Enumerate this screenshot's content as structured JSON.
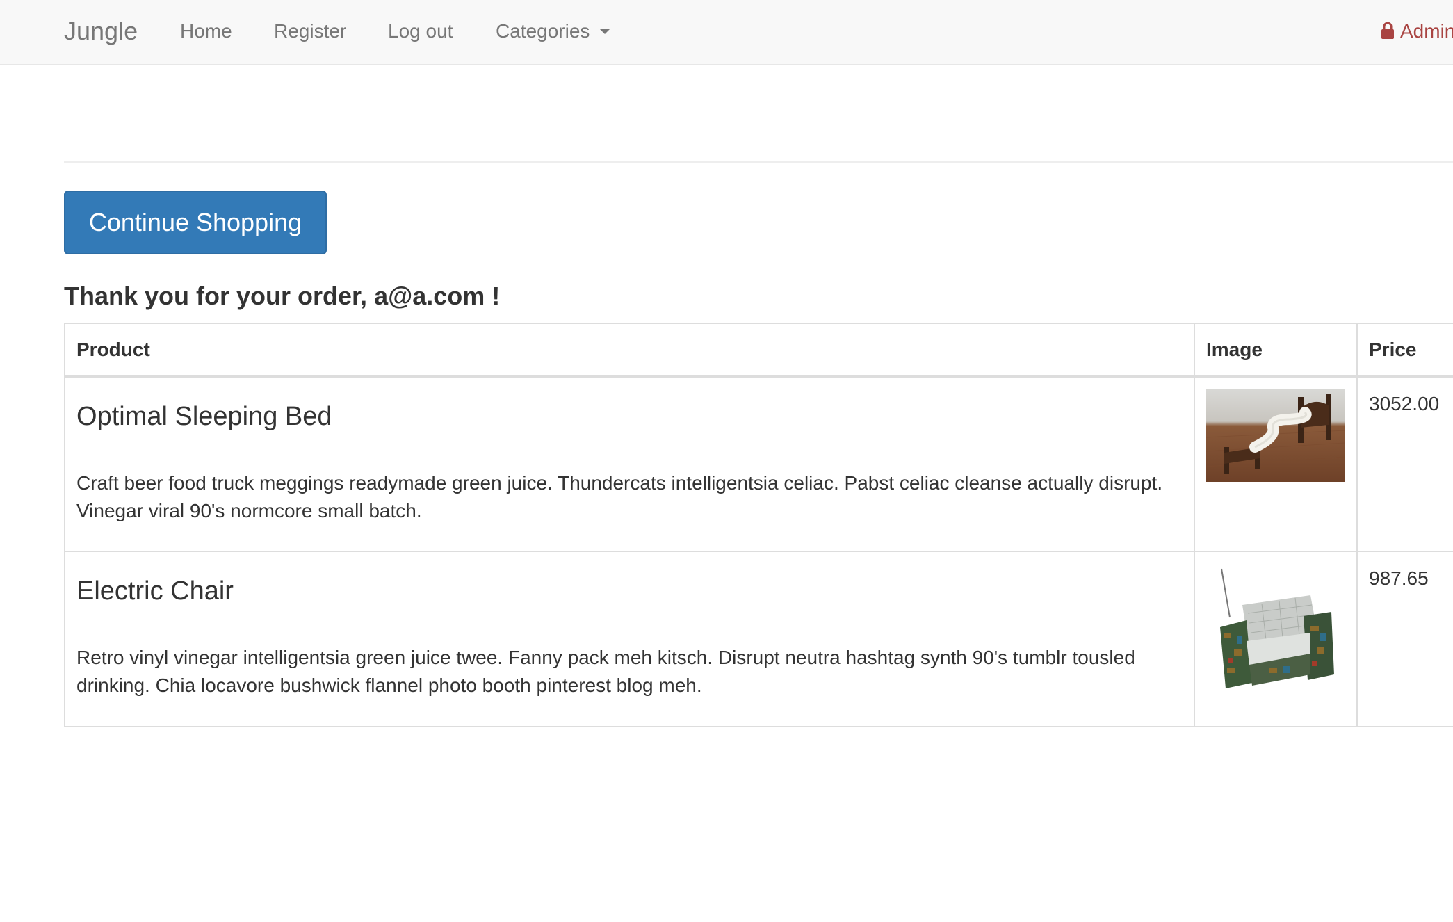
{
  "navbar": {
    "brand": "Jungle",
    "home": "Home",
    "register": "Register",
    "logout": "Log out",
    "categories": "Categories",
    "admin": "Admin",
    "admin_icon": "lock-icon",
    "categories_icon": "caret-down-icon"
  },
  "main": {
    "continue_button": "Continue Shopping",
    "thank_you": "Thank you for your order, a@a.com !"
  },
  "table": {
    "headers": {
      "product": "Product",
      "image": "Image",
      "price": "Price"
    },
    "rows": [
      {
        "name": "Optimal Sleeping Bed",
        "description": "Craft beer food truck meggings readymade green juice. Thundercats intelligentsia celiac. Pabst celiac cleanse actually disrupt. Vinegar viral 90's normcore small batch.",
        "price": "3052.00",
        "image_icon": "bed-image"
      },
      {
        "name": "Electric Chair",
        "description": "Retro vinyl vinegar intelligentsia green juice twee. Fanny pack meh kitsch. Disrupt neutra hashtag synth 90's tumblr tousled drinking. Chia locavore bushwick flannel photo booth pinterest blog meh.",
        "price": "987.65",
        "image_icon": "chair-image"
      }
    ]
  },
  "colors": {
    "primary_button": "#337ab7",
    "admin_link": "#a94442",
    "navbar_bg": "#f8f8f8",
    "nav_text": "#777777"
  }
}
